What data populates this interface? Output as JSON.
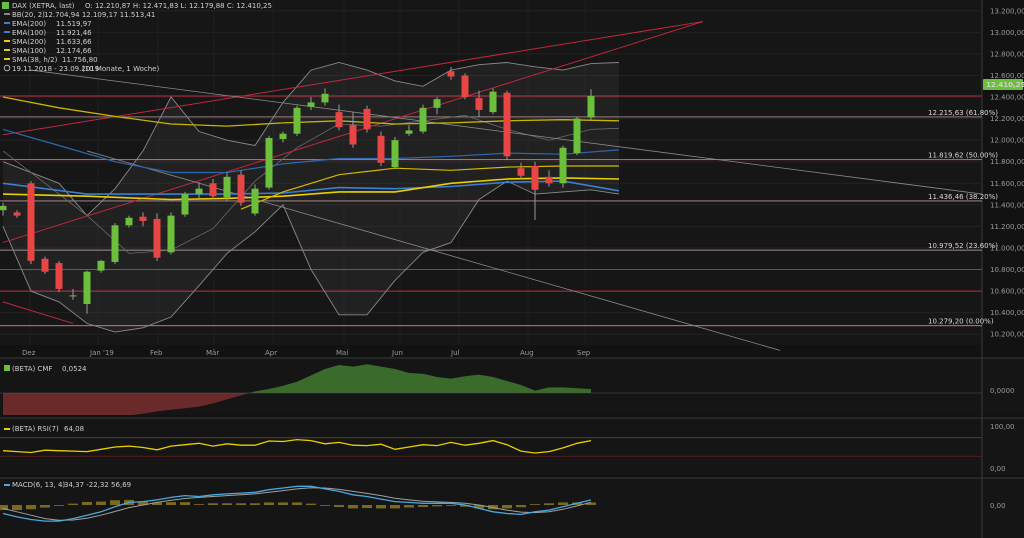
{
  "legend": {
    "title": "DAX (XETRA, last)",
    "ohlc": "O: 12.210,87  H: 12.471,83  L: 12.179,88  C: 12.410,25",
    "items": [
      {
        "label": "BB(20, 2)",
        "value": "12.704,94  12.109,17  11.513,41",
        "color": "#8a8a8a"
      },
      {
        "label": "EMA(200)",
        "value": "11.519,97",
        "color": "#3a7fd0"
      },
      {
        "label": "EMA(100)",
        "value": "11.921,46",
        "color": "#3a7fd0"
      },
      {
        "label": "SMA(200)",
        "value": "11.633,66",
        "color": "#e8d000"
      },
      {
        "label": "SMA(100)",
        "value": "12.174,66",
        "color": "#e8d000"
      },
      {
        "label": "SMA(38, h/2)",
        "value": "11.756,80",
        "color": "#e8d000"
      }
    ],
    "range": "19.11.2018 - 23.09.2019",
    "period": "(10 Monate, 1 Woche)"
  },
  "price_label": "12.410,25",
  "months": [
    "Dez",
    "Jan '19",
    "Feb",
    "Mär",
    "Apr",
    "Mai",
    "Jun",
    "Jul",
    "Aug",
    "Sep"
  ],
  "price_ticks": [
    "13.200,00",
    "13.000,00",
    "12.800,00",
    "12.600,00",
    "12.400,00",
    "12.200,00",
    "12.000,00",
    "11.800,00",
    "11.600,00",
    "11.400,00",
    "11.200,00",
    "11.000,00",
    "10.800,00",
    "10.600,00",
    "10.400,00",
    "10.200,00"
  ],
  "fib_labels": [
    "12.215,63 (61.80%)",
    "11.819,62 (50.00%)",
    "11.436,46 (38.20%)",
    "10.979,52 (23.60%)",
    "10.279,20 (0.00%)"
  ],
  "cmf": {
    "label": "(BETA) CMF",
    "value": "0,0524",
    "tick": "0,0000"
  },
  "rsi": {
    "label": "(BETA) RSI(7)",
    "value": "64,08",
    "ticks": [
      "100,00",
      "0,00"
    ]
  },
  "macd": {
    "label": "MACD(6, 13, 4)",
    "value": "34,37   -22,32   56,69",
    "tick": "0,00"
  },
  "colors": {
    "up": "#6bbf3a",
    "down": "#e84545",
    "bb": "#8a8a8a",
    "ema": "#3a7fd0",
    "sma": "#e8d000",
    "fib": "#c0283c"
  },
  "chart_data": {
    "type": "candlestick",
    "y_range": [
      10100,
      13300
    ],
    "fib_levels": [
      12410,
      12215.63,
      11819.62,
      11436.46,
      10979.52,
      10800,
      10600,
      10279.2
    ],
    "candles": [
      {
        "x": 0,
        "o": 11350,
        "h": 11420,
        "l": 11300,
        "c": 11390
      },
      {
        "x": 1,
        "o": 11330,
        "h": 11350,
        "l": 11280,
        "c": 11300
      },
      {
        "x": 2,
        "o": 11600,
        "h": 11620,
        "l": 10850,
        "c": 10880
      },
      {
        "x": 3,
        "o": 10900,
        "h": 10920,
        "l": 10760,
        "c": 10780
      },
      {
        "x": 4,
        "o": 10860,
        "h": 10880,
        "l": 10590,
        "c": 10620
      },
      {
        "x": 5,
        "o": 10560,
        "h": 10620,
        "l": 10520,
        "c": 10560
      },
      {
        "x": 6,
        "o": 10480,
        "h": 10790,
        "l": 10390,
        "c": 10780
      },
      {
        "x": 7,
        "o": 10790,
        "h": 10890,
        "l": 10770,
        "c": 10880
      },
      {
        "x": 8,
        "o": 10870,
        "h": 11230,
        "l": 10850,
        "c": 11210
      },
      {
        "x": 9,
        "o": 11210,
        "h": 11300,
        "l": 11190,
        "c": 11280
      },
      {
        "x": 10,
        "o": 11290,
        "h": 11330,
        "l": 11200,
        "c": 11250
      },
      {
        "x": 11,
        "o": 11270,
        "h": 11320,
        "l": 10880,
        "c": 10910
      },
      {
        "x": 12,
        "o": 10960,
        "h": 11330,
        "l": 10940,
        "c": 11300
      },
      {
        "x": 13,
        "o": 11310,
        "h": 11520,
        "l": 11290,
        "c": 11500
      },
      {
        "x": 14,
        "o": 11500,
        "h": 11610,
        "l": 11460,
        "c": 11550
      },
      {
        "x": 15,
        "o": 11600,
        "h": 11640,
        "l": 11450,
        "c": 11480
      },
      {
        "x": 16,
        "o": 11470,
        "h": 11700,
        "l": 11440,
        "c": 11660
      },
      {
        "x": 17,
        "o": 11680,
        "h": 11720,
        "l": 11390,
        "c": 11420
      },
      {
        "x": 18,
        "o": 11320,
        "h": 11590,
        "l": 11300,
        "c": 11550
      },
      {
        "x": 19,
        "o": 11560,
        "h": 12040,
        "l": 11540,
        "c": 12020
      },
      {
        "x": 20,
        "o": 12010,
        "h": 12080,
        "l": 11980,
        "c": 12060
      },
      {
        "x": 21,
        "o": 12060,
        "h": 12320,
        "l": 12040,
        "c": 12300
      },
      {
        "x": 22,
        "o": 12310,
        "h": 12400,
        "l": 12280,
        "c": 12350
      },
      {
        "x": 23,
        "o": 12350,
        "h": 12480,
        "l": 12320,
        "c": 12430
      },
      {
        "x": 24,
        "o": 12260,
        "h": 12330,
        "l": 12090,
        "c": 12120
      },
      {
        "x": 25,
        "o": 12140,
        "h": 12260,
        "l": 11930,
        "c": 11960
      },
      {
        "x": 26,
        "o": 12290,
        "h": 12320,
        "l": 12070,
        "c": 12100
      },
      {
        "x": 27,
        "o": 12040,
        "h": 12080,
        "l": 11760,
        "c": 11790
      },
      {
        "x": 28,
        "o": 11750,
        "h": 12030,
        "l": 11730,
        "c": 12000
      },
      {
        "x": 29,
        "o": 12060,
        "h": 12140,
        "l": 12040,
        "c": 12090
      },
      {
        "x": 30,
        "o": 12080,
        "h": 12330,
        "l": 12060,
        "c": 12300
      },
      {
        "x": 31,
        "o": 12300,
        "h": 12400,
        "l": 12240,
        "c": 12380
      },
      {
        "x": 32,
        "o": 12640,
        "h": 12680,
        "l": 12560,
        "c": 12590
      },
      {
        "x": 33,
        "o": 12600,
        "h": 12620,
        "l": 12380,
        "c": 12400
      },
      {
        "x": 34,
        "o": 12390,
        "h": 12460,
        "l": 12220,
        "c": 12280
      },
      {
        "x": 35,
        "o": 12260,
        "h": 12480,
        "l": 12240,
        "c": 12450
      },
      {
        "x": 36,
        "o": 12440,
        "h": 12460,
        "l": 11820,
        "c": 11850
      },
      {
        "x": 37,
        "o": 11740,
        "h": 11790,
        "l": 11640,
        "c": 11670
      },
      {
        "x": 38,
        "o": 11760,
        "h": 11800,
        "l": 11260,
        "c": 11540
      },
      {
        "x": 39,
        "o": 11660,
        "h": 11720,
        "l": 11570,
        "c": 11600
      },
      {
        "x": 40,
        "o": 11600,
        "h": 11950,
        "l": 11560,
        "c": 11930
      },
      {
        "x": 41,
        "o": 11880,
        "h": 12220,
        "l": 11860,
        "c": 12200
      },
      {
        "x": 42,
        "o": 12210,
        "h": 12472,
        "l": 12180,
        "c": 12410
      }
    ],
    "bb_upper": [
      [
        0,
        11800
      ],
      [
        4,
        11600
      ],
      [
        6,
        11300
      ],
      [
        8,
        11550
      ],
      [
        10,
        11900
      ],
      [
        12,
        12400
      ],
      [
        14,
        12080
      ],
      [
        16,
        12000
      ],
      [
        18,
        11950
      ],
      [
        20,
        12350
      ],
      [
        22,
        12650
      ],
      [
        24,
        12720
      ],
      [
        26,
        12650
      ],
      [
        28,
        12550
      ],
      [
        30,
        12500
      ],
      [
        32,
        12650
      ],
      [
        34,
        12700
      ],
      [
        36,
        12720
      ],
      [
        38,
        12680
      ],
      [
        40,
        12650
      ],
      [
        42,
        12710
      ],
      [
        44,
        12720
      ]
    ],
    "bb_lower": [
      [
        0,
        11200
      ],
      [
        2,
        10600
      ],
      [
        4,
        10500
      ],
      [
        6,
        10300
      ],
      [
        8,
        10220
      ],
      [
        10,
        10260
      ],
      [
        12,
        10360
      ],
      [
        14,
        10650
      ],
      [
        16,
        10950
      ],
      [
        18,
        11150
      ],
      [
        20,
        11400
      ],
      [
        22,
        10800
      ],
      [
        24,
        10380
      ],
      [
        26,
        10380
      ],
      [
        28,
        10700
      ],
      [
        30,
        10960
      ],
      [
        32,
        11050
      ],
      [
        34,
        11450
      ],
      [
        36,
        11620
      ],
      [
        38,
        11500
      ],
      [
        40,
        11520
      ],
      [
        42,
        11540
      ],
      [
        44,
        11500
      ]
    ],
    "bb_mid": [
      [
        0,
        11900
      ],
      [
        3,
        11600
      ],
      [
        6,
        11300
      ],
      [
        9,
        10950
      ],
      [
        12,
        10980
      ],
      [
        15,
        11180
      ],
      [
        18,
        11620
      ],
      [
        21,
        11930
      ],
      [
        24,
        12150
      ],
      [
        27,
        12130
      ],
      [
        30,
        12180
      ],
      [
        33,
        12230
      ],
      [
        36,
        12100
      ],
      [
        39,
        12000
      ],
      [
        42,
        12100
      ],
      [
        44,
        12110
      ]
    ],
    "ema200": [
      [
        0,
        12100
      ],
      [
        4,
        11950
      ],
      [
        8,
        11800
      ],
      [
        12,
        11700
      ],
      [
        16,
        11700
      ],
      [
        20,
        11780
      ],
      [
        24,
        11830
      ],
      [
        28,
        11830
      ],
      [
        32,
        11850
      ],
      [
        36,
        11880
      ],
      [
        40,
        11870
      ],
      [
        44,
        11910
      ]
    ],
    "ema100": [
      [
        0,
        11600
      ],
      [
        6,
        11500
      ],
      [
        10,
        11500
      ],
      [
        16,
        11500
      ],
      [
        20,
        11510
      ],
      [
        24,
        11560
      ],
      [
        28,
        11550
      ],
      [
        32,
        11570
      ],
      [
        36,
        11610
      ],
      [
        40,
        11620
      ],
      [
        44,
        11530
      ]
    ],
    "sma200": [
      [
        0,
        12400
      ],
      [
        4,
        12300
      ],
      [
        8,
        12220
      ],
      [
        12,
        12150
      ],
      [
        16,
        12130
      ],
      [
        20,
        12160
      ],
      [
        24,
        12180
      ],
      [
        28,
        12150
      ],
      [
        32,
        12160
      ],
      [
        36,
        12180
      ],
      [
        40,
        12190
      ],
      [
        44,
        12180
      ]
    ],
    "sma100": [
      [
        0,
        11500
      ],
      [
        6,
        11480
      ],
      [
        12,
        11450
      ],
      [
        16,
        11460
      ],
      [
        20,
        11480
      ],
      [
        24,
        11520
      ],
      [
        28,
        11520
      ],
      [
        32,
        11600
      ],
      [
        36,
        11640
      ],
      [
        40,
        11650
      ],
      [
        44,
        11640
      ]
    ],
    "sma38": [
      [
        17,
        11360
      ],
      [
        20,
        11520
      ],
      [
        24,
        11680
      ],
      [
        28,
        11740
      ],
      [
        32,
        11720
      ],
      [
        36,
        11750
      ],
      [
        40,
        11760
      ],
      [
        44,
        11760
      ]
    ],
    "cmf": [
      -0.28,
      -0.3,
      -0.32,
      -0.33,
      -0.34,
      -0.33,
      -0.33,
      -0.32,
      -0.3,
      -0.28,
      -0.26,
      -0.23,
      -0.21,
      -0.19,
      -0.17,
      -0.13,
      -0.08,
      -0.03,
      0.02,
      0.05,
      0.09,
      0.14,
      0.22,
      0.3,
      0.35,
      0.33,
      0.36,
      0.33,
      0.3,
      0.25,
      0.24,
      0.2,
      0.18,
      0.21,
      0.23,
      0.2,
      0.15,
      0.1,
      0.03,
      0.07,
      0.07,
      0.06,
      0.05
    ],
    "rsi": [
      42,
      40,
      38,
      43,
      42,
      41,
      40,
      45,
      50,
      52,
      49,
      44,
      52,
      55,
      58,
      52,
      57,
      54,
      54,
      63,
      62,
      66,
      64,
      57,
      60,
      54,
      53,
      56,
      45,
      50,
      55,
      53,
      60,
      54,
      58,
      64,
      55,
      41,
      37,
      40,
      48,
      58,
      64
    ],
    "macd_line": [
      -50,
      -70,
      -85,
      -95,
      -95,
      -80,
      -60,
      -40,
      -10,
      15,
      20,
      30,
      45,
      55,
      50,
      60,
      65,
      70,
      75,
      90,
      100,
      110,
      110,
      95,
      80,
      60,
      50,
      35,
      20,
      15,
      10,
      10,
      10,
      0,
      -20,
      -40,
      -50,
      -55,
      -40,
      -30,
      -10,
      10,
      30
    ],
    "macd_signal": [
      -20,
      -40,
      -60,
      -80,
      -90,
      -88,
      -78,
      -60,
      -38,
      -15,
      0,
      15,
      28,
      38,
      45,
      50,
      55,
      60,
      65,
      75,
      85,
      95,
      102,
      100,
      92,
      80,
      68,
      55,
      40,
      30,
      22,
      18,
      15,
      10,
      0,
      -15,
      -30,
      -42,
      -45,
      -40,
      -25,
      -5,
      15
    ],
    "macd_hist": [
      -30,
      -30,
      -25,
      -15,
      -5,
      8,
      18,
      20,
      28,
      30,
      20,
      15,
      17,
      17,
      5,
      10,
      10,
      10,
      10,
      15,
      15,
      15,
      8,
      -5,
      -12,
      -20,
      -18,
      -20,
      -20,
      -15,
      -12,
      -8,
      -5,
      -10,
      -20,
      -25,
      -20,
      -13,
      5,
      10,
      15,
      15,
      15
    ],
    "x_count": 46
  }
}
